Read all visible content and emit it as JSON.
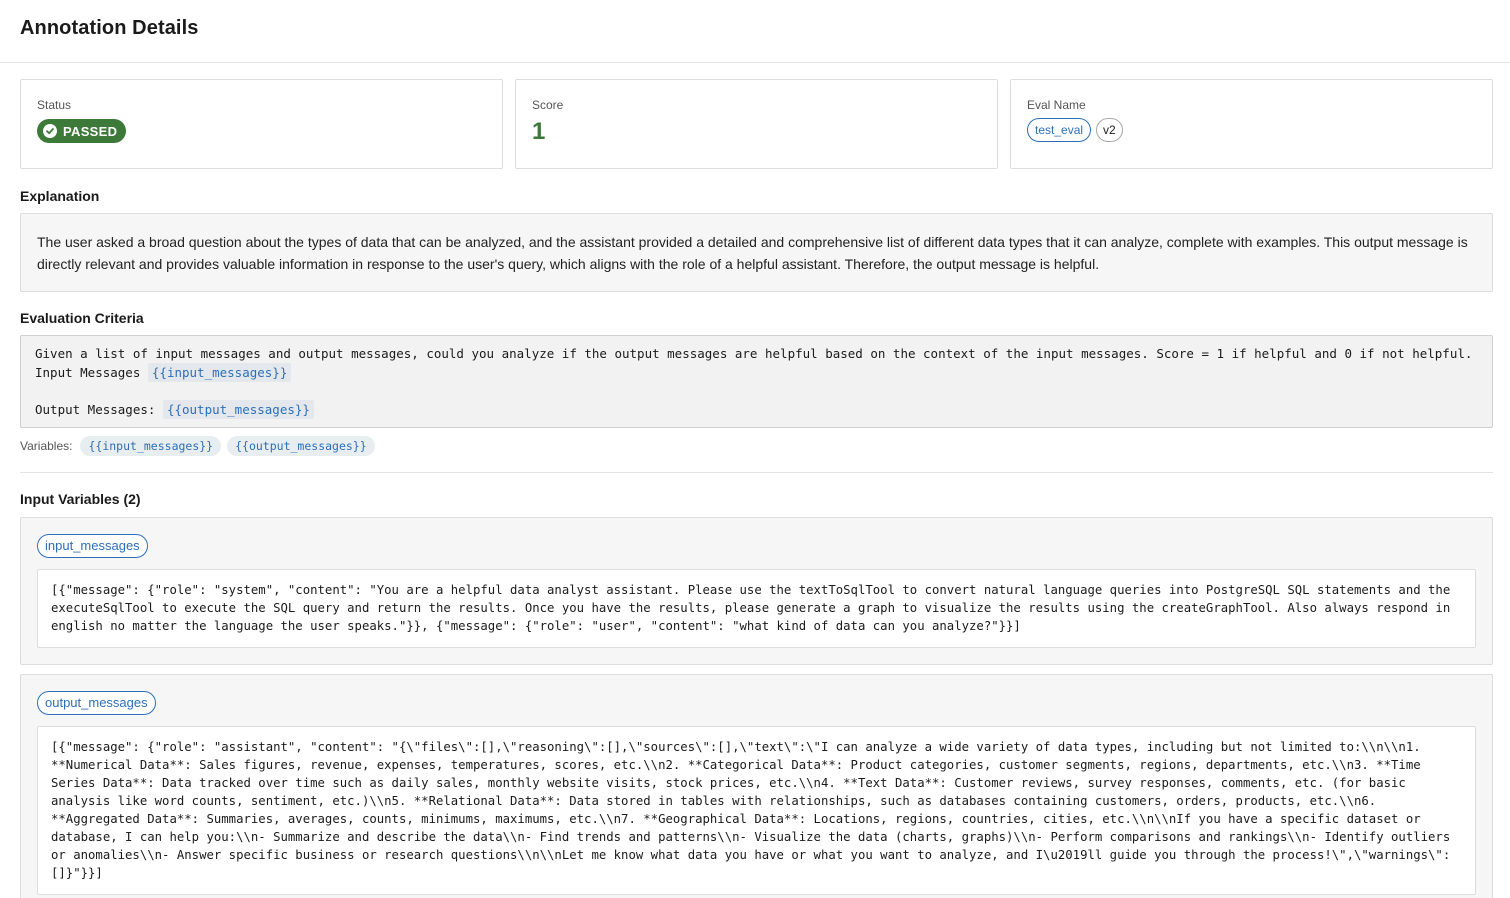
{
  "header": {
    "title": "Annotation Details"
  },
  "cards": {
    "status": {
      "label": "Status",
      "value": "PASSED",
      "color": "#3d7a3a",
      "icon": "check-circle-icon"
    },
    "score": {
      "label": "Score",
      "value": "1",
      "color": "#3d7a3a"
    },
    "eval_name": {
      "label": "Eval Name",
      "name": "test_eval",
      "version": "v2"
    }
  },
  "explanation": {
    "title": "Explanation",
    "text": "The user asked a broad question about the types of data that can be analyzed, and the assistant provided a detailed and comprehensive list of different data types that it can analyze, complete with examples. This output message is directly relevant and provides valuable information in response to the user's query, which aligns with the role of a helpful assistant. Therefore, the output message is helpful."
  },
  "criteria": {
    "title": "Evaluation Criteria",
    "line1": "Given a list of input messages and output messages, could you analyze if the output messages are helpful based on the context of the input messages. Score = 1 if helpful and 0 if not helpful. Input Messages",
    "var1": "{{input_messages}}",
    "line2": "Output Messages:",
    "var2": "{{output_messages}}",
    "variables_label": "Variables:",
    "variables": [
      "{{input_messages}}",
      "{{output_messages}}"
    ]
  },
  "input_variables": {
    "title": "Input Variables (2)",
    "items": [
      {
        "name": "input_messages",
        "value": "[{\"message\": {\"role\": \"system\", \"content\": \"You are a helpful data analyst assistant. Please use the textToSqlTool to convert natural language queries into PostgreSQL SQL statements and the executeSqlTool to execute the SQL query and return the results. Once you have the results, please generate a graph to visualize the results using the createGraphTool. Also always respond in english no matter the language the user speaks.\"}}, {\"message\": {\"role\": \"user\", \"content\": \"what kind of data can you analyze?\"}}]"
      },
      {
        "name": "output_messages",
        "value": "[{\"message\": {\"role\": \"assistant\", \"content\": \"{\\\"files\\\":[],\\\"reasoning\\\":[],\\\"sources\\\":[],\\\"text\\\":\\\"I can analyze a wide variety of data types, including but not limited to:\\\\n\\\\n1. **Numerical Data**: Sales figures, revenue, expenses, temperatures, scores, etc.\\\\n2. **Categorical Data**: Product categories, customer segments, regions, departments, etc.\\\\n3. **Time Series Data**: Data tracked over time such as daily sales, monthly website visits, stock prices, etc.\\\\n4. **Text Data**: Customer reviews, survey responses, comments, etc. (for basic analysis like word counts, sentiment, etc.)\\\\n5. **Relational Data**: Data stored in tables with relationships, such as databases containing customers, orders, products, etc.\\\\n6. **Aggregated Data**: Summaries, averages, counts, minimums, maximums, etc.\\\\n7. **Geographical Data**: Locations, regions, countries, cities, etc.\\\\n\\\\nIf you have a specific dataset or database, I can help you:\\\\n- Summarize and describe the data\\\\n- Find trends and patterns\\\\n- Visualize the data (charts, graphs)\\\\n- Perform comparisons and rankings\\\\n- Identify outliers or anomalies\\\\n- Answer specific business or research questions\\\\n\\\\nLet me know what data you have or what you want to analyze, and I\\u2019ll guide you through the process!\\\",\\\"warnings\\\":[]}\"}}]"
      }
    ]
  }
}
